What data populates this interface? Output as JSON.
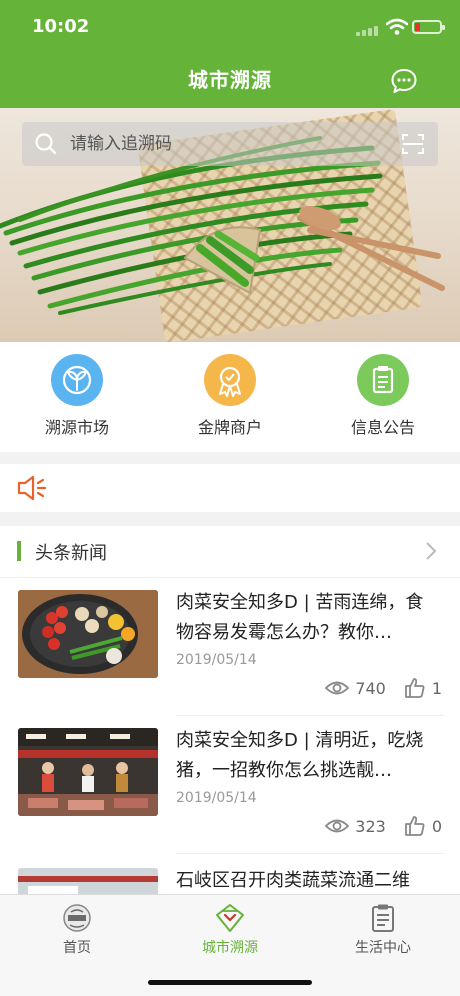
{
  "status": {
    "time": "10:02"
  },
  "nav": {
    "title": "城市溯源",
    "chat_icon": "chat-bubble-icon"
  },
  "search": {
    "placeholder": "请输入追溯码",
    "icon": "search-icon",
    "scan_icon": "scan-icon"
  },
  "quick_menu": [
    {
      "label": "溯源市场",
      "icon": "leaf-icon",
      "color": "#5ab4f0"
    },
    {
      "label": "金牌商户",
      "icon": "medal-icon",
      "color": "#f5b64a"
    },
    {
      "label": "信息公告",
      "icon": "clipboard-icon",
      "color": "#7cc95c"
    }
  ],
  "notice": {
    "icon": "speaker-icon",
    "color": "#e8622a"
  },
  "news": {
    "title": "头条新闻",
    "items": [
      {
        "title": "肉菜安全知多D | 苦雨连绵，食物容易发霉怎么办？教你…",
        "date": "2019/05/14",
        "views": "740",
        "likes": "1"
      },
      {
        "title": "肉菜安全知多D | 清明近，吃烧猪，一招教你怎么挑选靓…",
        "date": "2019/05/14",
        "views": "323",
        "likes": "0"
      },
      {
        "title": "石岐区召开肉类蔬菜流通二维",
        "date": "",
        "views": "",
        "likes": ""
      }
    ]
  },
  "tabs": [
    {
      "label": "首页",
      "icon": "home-logo-icon"
    },
    {
      "label": "城市溯源",
      "icon": "trace-icon"
    },
    {
      "label": "生活中心",
      "icon": "clipboard-icon"
    }
  ],
  "colors": {
    "brand": "#66b33a",
    "background": "#f2f2f2"
  }
}
